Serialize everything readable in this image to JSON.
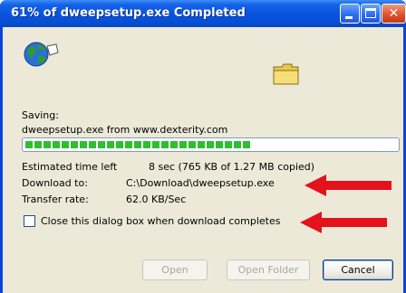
{
  "window": {
    "title": "61% of dweepsetup.exe Completed",
    "progress_fraction": 0.61
  },
  "status": {
    "saving_label": "Saving:",
    "saving_value": "dweepsetup.exe from www.dexterity.com"
  },
  "details": {
    "time_left_label": "Estimated time left",
    "time_left_value": "8 sec (765 KB of 1.27 MB copied)",
    "download_to_label": "Download to:",
    "download_to_value": "C:\\Download\\dweepsetup.exe",
    "transfer_rate_label": "Transfer rate:",
    "transfer_rate_value": "62.0 KB/Sec"
  },
  "options": {
    "close_when_done_label": "Close this dialog box when download completes",
    "close_when_done_checked": false
  },
  "buttons": {
    "open": "Open",
    "open_folder": "Open Folder",
    "cancel": "Cancel"
  },
  "icons": {
    "globe": "globe-icon",
    "folder": "folder-icon",
    "arrow": "red-arrow-icon"
  },
  "colors": {
    "accent": "#0a55e0",
    "progress": "#2fbe2f",
    "arrow": "#e3121b"
  }
}
